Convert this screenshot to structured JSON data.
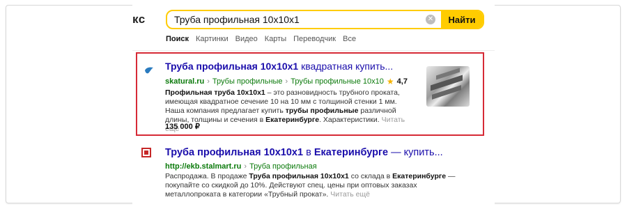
{
  "header": {
    "logo_fragment": "кс",
    "search": {
      "value": "Труба профильная 10x10x1",
      "clear_icon": "clear-icon",
      "button_label": "Найти"
    },
    "tabs": [
      {
        "label": "Поиск",
        "active": true
      },
      {
        "label": "Картинки"
      },
      {
        "label": "Видео"
      },
      {
        "label": "Карты"
      },
      {
        "label": "Переводчик"
      },
      {
        "label": "Все"
      }
    ]
  },
  "results": [
    {
      "title_bold": "Труба профильная 10x10x1",
      "title_rest": " квадратная купить...",
      "domain": "skatural.ru",
      "breadcrumb": [
        "Трубы профильные",
        "Трубы профильные 10x10"
      ],
      "rating": "4,7",
      "snippet_parts": [
        {
          "text": "Профильная труба 10x10x1",
          "bold": true
        },
        {
          "text": " – это разновидность трубного проката, имеющая квадратное сечение 10 на 10 мм с толщиной стенки 1 мм. Наша компания предлагает купить ",
          "bold": false
        },
        {
          "text": "трубы профильные",
          "bold": true
        },
        {
          "text": " различной длины, толщины и сечения в ",
          "bold": false
        },
        {
          "text": "Екатеринбурге",
          "bold": true
        },
        {
          "text": ". Характеристики. ",
          "bold": false
        }
      ],
      "read_more": "Читать ещё",
      "price": "135 000 ₽",
      "highlight_color": "#d62a36"
    },
    {
      "title_bold": "Труба профильная 10x10x1",
      "title_rest": " в ",
      "title_bold2": "Екатеринбурге",
      "title_rest2": " — купить...",
      "domain": "http://ekb.stalmart.ru",
      "breadcrumb": [
        "Труба профильная"
      ],
      "snippet_parts": [
        {
          "text": "Распродажа. В продаже ",
          "bold": false
        },
        {
          "text": "Труба профильная 10x10x1",
          "bold": true
        },
        {
          "text": " со склада в ",
          "bold": false
        },
        {
          "text": "Екатеринбурге",
          "bold": true
        },
        {
          "text": " — покупайте со скидкой до 10%. Действуют спец. цены при оптовых заказах металлопроката в категории «Трубный прокат». ",
          "bold": false
        }
      ],
      "read_more": "Читать ещё"
    }
  ],
  "colors": {
    "search_accent": "#ffcc00",
    "title_link": "#1a0dab",
    "url_green": "#0b7a0b",
    "highlight_border": "#d62a36"
  }
}
